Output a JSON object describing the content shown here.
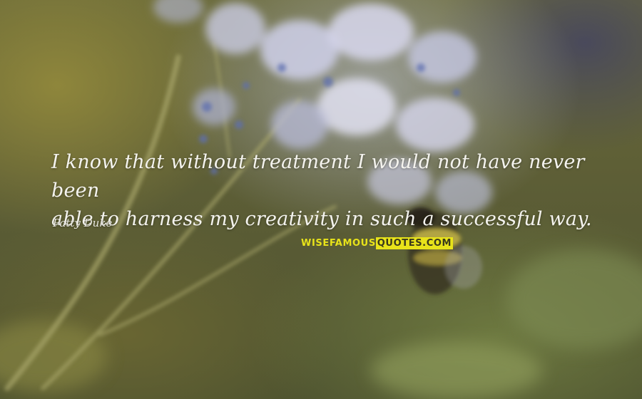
{
  "quote": {
    "line1": "I know that without treatment I would not have never been",
    "line2": "able to harness my creativity in such a successful way."
  },
  "author": "Patty Duke",
  "watermark": {
    "part1": "WISEFAMOUS",
    "part2": "QUOTES.COM"
  },
  "colors": {
    "text": "#f4f3ee",
    "watermark_yellow": "#e8e31a"
  }
}
